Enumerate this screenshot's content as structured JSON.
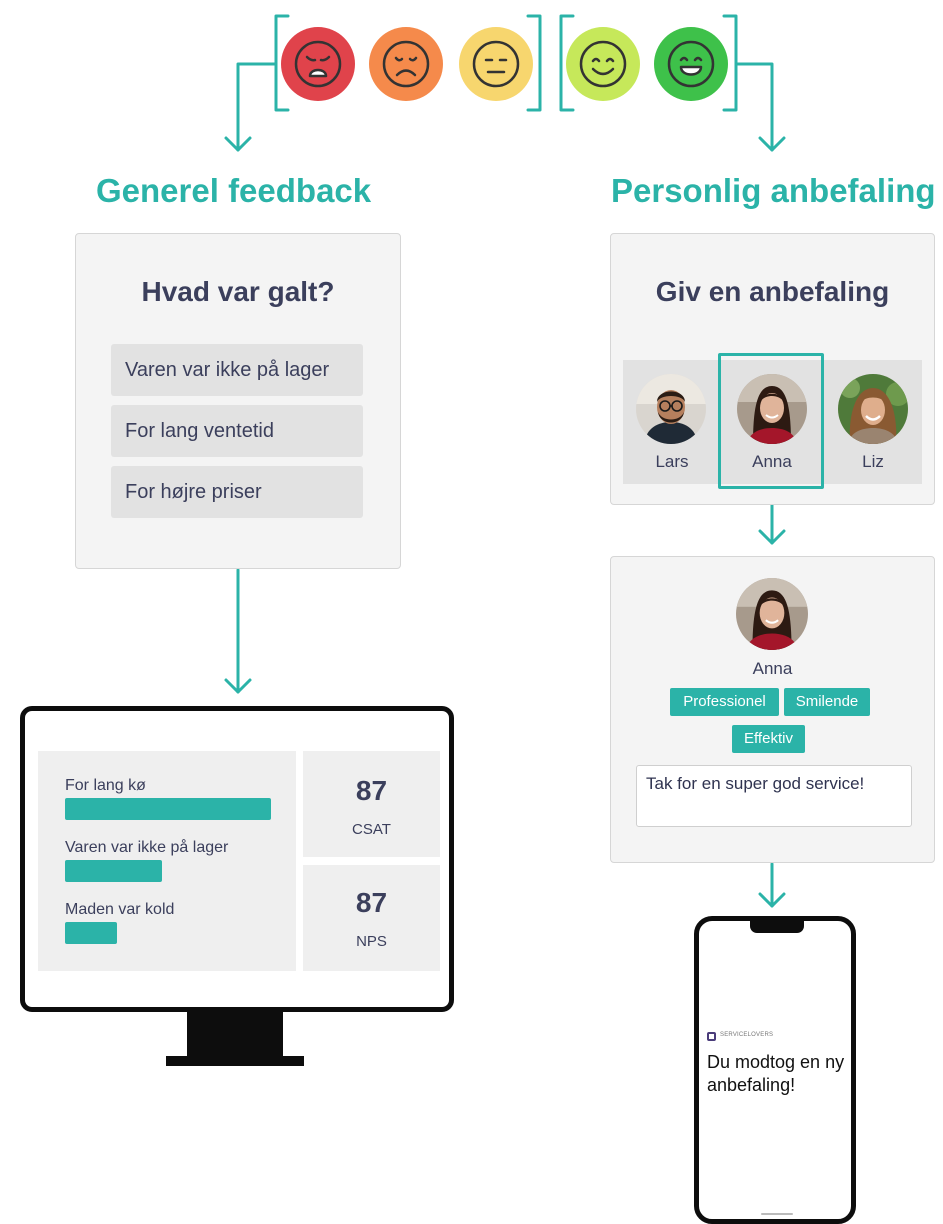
{
  "faces": [
    {
      "mood": "very-unhappy",
      "color": "#e0434b",
      "icon": "crying-face-icon"
    },
    {
      "mood": "unhappy",
      "color": "#f58a4b",
      "icon": "frowning-face-icon"
    },
    {
      "mood": "neutral",
      "color": "#f7d66e",
      "icon": "neutral-face-icon"
    },
    {
      "mood": "happy",
      "color": "#c6e85a",
      "icon": "smiling-face-icon"
    },
    {
      "mood": "very-happy",
      "color": "#3ec14a",
      "icon": "grinning-face-icon"
    }
  ],
  "accent_color": "#2bb3a8",
  "left": {
    "title": "Generel feedback",
    "card_title": "Hvad var galt?",
    "options": [
      "Varen var ikke på lager",
      "For lang ventetid",
      "For højre priser"
    ]
  },
  "right": {
    "title": "Personlig anbefaling",
    "card_title": "Giv en anbefaling",
    "people": [
      {
        "name": "Lars",
        "selected": false
      },
      {
        "name": "Anna",
        "selected": true
      },
      {
        "name": "Liz",
        "selected": false
      }
    ]
  },
  "recommendation": {
    "name": "Anna",
    "tags": [
      "Professionel",
      "Smilende",
      "Effektiv"
    ],
    "comment": "Tak for en super god service!"
  },
  "dashboard": {
    "bars": [
      {
        "label": "For lang kø",
        "value": 1.0
      },
      {
        "label": "Varen var ikke på lager",
        "value": 0.47
      },
      {
        "label": "Maden var kold",
        "value": 0.25
      }
    ],
    "kpis": [
      {
        "value": "87",
        "label": "CSAT"
      },
      {
        "value": "87",
        "label": "NPS"
      }
    ]
  },
  "phone": {
    "brand": "SERVICELOVERS",
    "message": "Du modtog en ny anbefaling!"
  }
}
